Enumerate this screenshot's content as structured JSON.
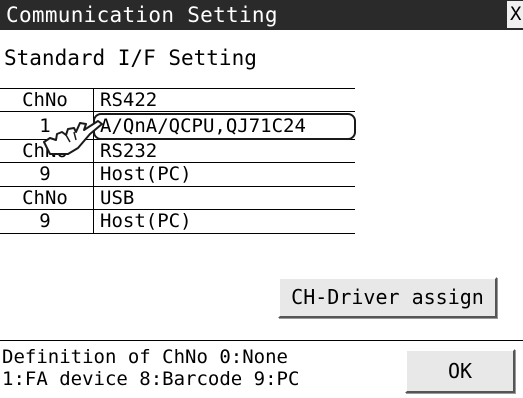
{
  "window": {
    "title": "Communication Setting",
    "close_label": "X"
  },
  "subtitle": "Standard I/F Setting",
  "table": [
    {
      "no": "ChNo",
      "value": "RS422",
      "is_header": true
    },
    {
      "no": "1",
      "value": "A/QnA/QCPU,QJ71C24",
      "is_header": false
    },
    {
      "no": "ChNo",
      "value": "RS232",
      "is_header": true
    },
    {
      "no": "9",
      "value": "Host(PC)",
      "is_header": false
    },
    {
      "no": "ChNo",
      "value": "USB",
      "is_header": true
    },
    {
      "no": "9",
      "value": "Host(PC)",
      "is_header": false
    }
  ],
  "buttons": {
    "ch_driver_assign": "CH-Driver assign",
    "ok": "OK"
  },
  "footer": {
    "line1": "Definition of ChNo  0:None",
    "line2": "1:FA device 8:Barcode 9:PC"
  }
}
